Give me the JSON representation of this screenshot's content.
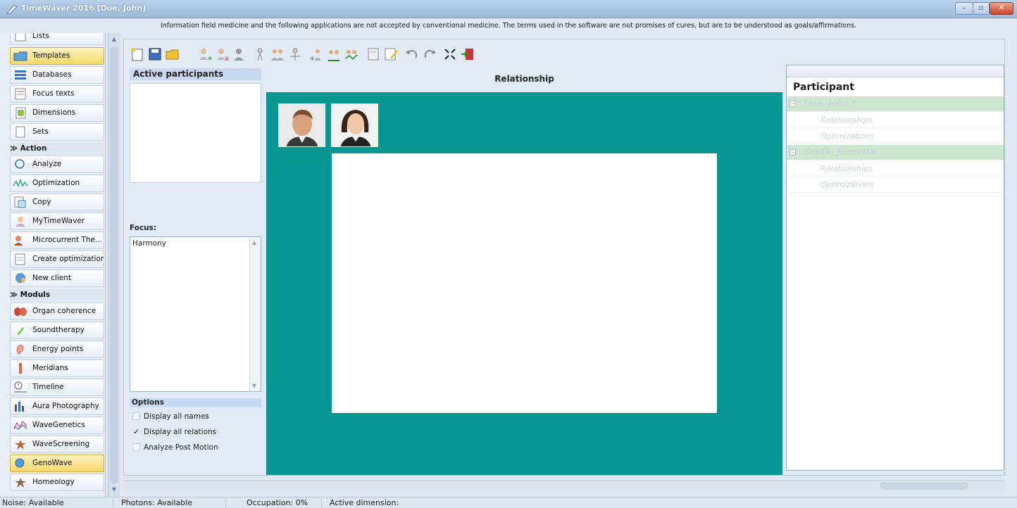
{
  "window": {
    "title": "TimeWaver 2016 [Doe, John]",
    "minimize_label": "–",
    "maximize_label": "▫",
    "close_label": "✕"
  },
  "disclaimer": "Information field medicine and the following applications are not accepted by conventional medicine. The terms used in the software are not promises of cures, but are to be understood as goals/affirmations.",
  "nav": {
    "top_items": [
      {
        "label": "Lists",
        "icon": "list-icon"
      },
      {
        "label": "Templates",
        "icon": "folder-icon",
        "selected": true
      },
      {
        "label": "Databases",
        "icon": "database-icon"
      },
      {
        "label": "Focus texts",
        "icon": "text-icon"
      },
      {
        "label": "Dimensions",
        "icon": "dimensions-icon"
      },
      {
        "label": "Sets",
        "icon": "document-icon"
      }
    ],
    "action_header": "≫ Action",
    "action_items": [
      {
        "label": "Analyze",
        "icon": "magnifier-icon"
      },
      {
        "label": "Optimization",
        "icon": "wave-icon"
      },
      {
        "label": "Copy",
        "icon": "copy-icon"
      },
      {
        "label": "MyTimeWaver",
        "icon": "person-icon"
      },
      {
        "label": "Microcurrent The...",
        "icon": "microcurrent-icon"
      },
      {
        "label": "Create optimization",
        "icon": "create-document-icon"
      },
      {
        "label": "New client",
        "icon": "new-client-icon"
      }
    ],
    "moduls_header": "≫ Moduls",
    "module_items": [
      {
        "label": "Organ coherence",
        "icon": "organ-icon"
      },
      {
        "label": "Soundtherapy",
        "icon": "sound-icon"
      },
      {
        "label": "Energy points",
        "icon": "ear-icon"
      },
      {
        "label": "Meridians",
        "icon": "meridian-icon"
      },
      {
        "label": "Timeline",
        "icon": "clock-icon"
      },
      {
        "label": "Aura Photography",
        "icon": "aura-icon"
      },
      {
        "label": "WaveGenetics",
        "icon": "dna-icon"
      },
      {
        "label": "WaveScreening",
        "icon": "screening-icon"
      },
      {
        "label": "GenoWave",
        "icon": "genowave-icon",
        "selected": true
      },
      {
        "label": "Homeology",
        "icon": "homeology-icon"
      }
    ]
  },
  "main": {
    "active_participants_title": "Active participants",
    "focus_label": "Focus:",
    "focus_items": [
      "Harmony"
    ],
    "options_title": "Options",
    "options": [
      {
        "label": "Display all names",
        "checked": false
      },
      {
        "label": "Display all relations",
        "checked": true
      },
      {
        "label": "Analyze Post Motion",
        "checked": false
      }
    ],
    "relationship_title": "Relationship",
    "canvas_color": "#089693"
  },
  "participants": {
    "title": "Participant",
    "groups": [
      {
        "name": "Doe, John *",
        "children": [
          "Relationships",
          "Optimizations"
        ]
      },
      {
        "name": "Smith, Jeanette",
        "children": [
          "Relationships",
          "Optimizations"
        ]
      }
    ]
  },
  "status": {
    "noise": "Noise: Available",
    "photons": "Photons: Available",
    "occupation": "Occupation: 0%",
    "dimension": "Active dimension:"
  }
}
